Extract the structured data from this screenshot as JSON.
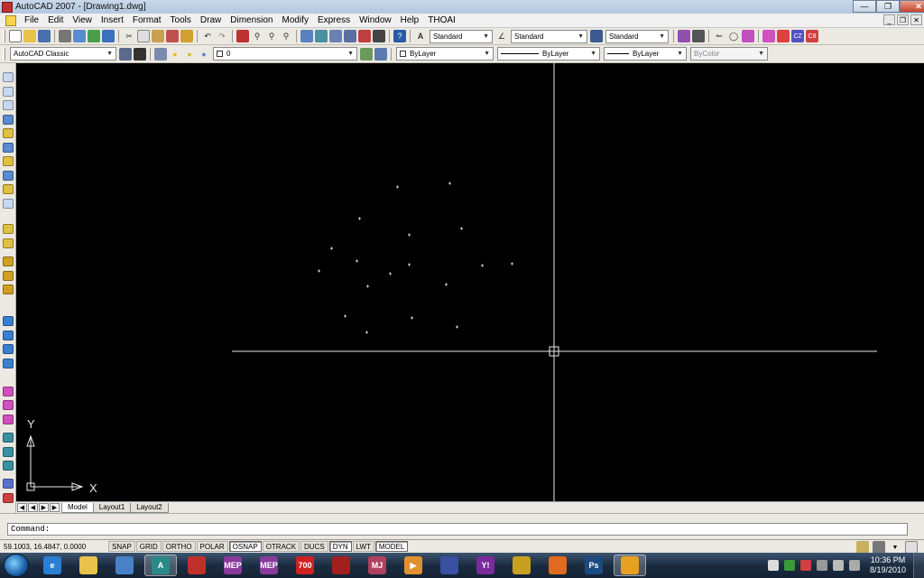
{
  "window": {
    "title": "AutoCAD 2007 - [Drawing1.dwg]"
  },
  "menu": [
    "File",
    "Edit",
    "View",
    "Insert",
    "Format",
    "Tools",
    "Draw",
    "Dimension",
    "Modify",
    "Express",
    "Window",
    "Help",
    "THOAI"
  ],
  "styles": {
    "text_style": "Standard",
    "dim_style": "Standard",
    "table_style": "Standard"
  },
  "workspace": "AutoCAD Classic",
  "layer": {
    "current": "0"
  },
  "properties": {
    "color": "ByLayer",
    "linetype": "ByLayer",
    "lineweight": "ByLayer",
    "plot_style": "ByColor"
  },
  "ucs": {
    "y_label": "Y",
    "x_label": "X"
  },
  "tabs": [
    "Model",
    "Layout1",
    "Layout2"
  ],
  "command": {
    "prompt": "Command:"
  },
  "status": {
    "coords": "59.1003, 16.4847, 0.0000",
    "toggles": [
      {
        "label": "SNAP",
        "on": false
      },
      {
        "label": "GRID",
        "on": false
      },
      {
        "label": "ORTHO",
        "on": false
      },
      {
        "label": "POLAR",
        "on": false
      },
      {
        "label": "OSNAP",
        "on": true
      },
      {
        "label": "OTRACK",
        "on": false
      },
      {
        "label": "DUCS",
        "on": false
      },
      {
        "label": "DYN",
        "on": true
      },
      {
        "label": "LWT",
        "on": false
      },
      {
        "label": "MODEL",
        "on": true
      }
    ]
  },
  "taskbar": {
    "apps": [
      {
        "name": "internet-explorer",
        "label": "e",
        "color": "#2a7fd4"
      },
      {
        "name": "windows-explorer",
        "label": "",
        "color": "#e8c24a"
      },
      {
        "name": "outlook",
        "label": "",
        "color": "#4a80c8"
      },
      {
        "name": "autocad",
        "label": "A",
        "color": "#2a8a8a",
        "active": true
      },
      {
        "name": "adobe-reader",
        "label": "",
        "color": "#c0302a"
      },
      {
        "name": "mep-1",
        "label": "MEP",
        "color": "#8a3a9a"
      },
      {
        "name": "mep-2",
        "label": "MEP",
        "color": "#8a3a9a"
      },
      {
        "name": "app-700",
        "label": "700",
        "color": "#d02020"
      },
      {
        "name": "app-red",
        "label": "",
        "color": "#a02020"
      },
      {
        "name": "app-mj",
        "label": "MJ",
        "color": "#b04060"
      },
      {
        "name": "media-player",
        "label": "▶",
        "color": "#e09030"
      },
      {
        "name": "app-swoosh",
        "label": "",
        "color": "#3a50a0"
      },
      {
        "name": "yahoo-messenger",
        "label": "Y!",
        "color": "#7a2a9a"
      },
      {
        "name": "dvd-app",
        "label": "",
        "color": "#c8a020"
      },
      {
        "name": "firefox",
        "label": "",
        "color": "#e06a20"
      },
      {
        "name": "photoshop",
        "label": "Ps",
        "color": "#1a4a80"
      },
      {
        "name": "app-orange",
        "label": "",
        "color": "#e8a020",
        "active": true
      }
    ],
    "time": "10:36 PM",
    "date": "8/19/2010"
  }
}
